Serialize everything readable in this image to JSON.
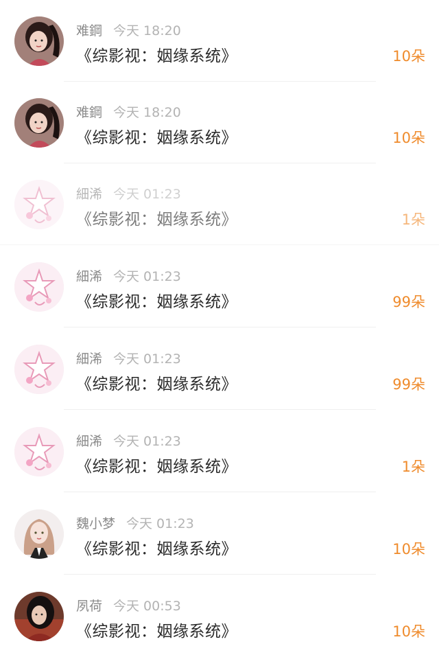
{
  "rows": [
    {
      "user": "难鋼",
      "time": "今天 18:20",
      "title": "《综影视：姻缘系统》",
      "gift": "10朵",
      "avatar": "avatar-girl-red"
    },
    {
      "user": "难鋼",
      "time": "今天 18:20",
      "title": "《综影视：姻缘系统》",
      "gift": "10朵",
      "avatar": "avatar-girl-red"
    },
    {
      "user": "細浠",
      "time": "今天 01:23",
      "title": "《综影视：姻缘系统》",
      "gift": "1朵",
      "avatar": "avatar-star-pink"
    },
    {
      "user": "細浠",
      "time": "今天 01:23",
      "title": "《综影视：姻缘系统》",
      "gift": "99朵",
      "avatar": "avatar-star-pink"
    },
    {
      "user": "細浠",
      "time": "今天 01:23",
      "title": "《综影视：姻缘系统》",
      "gift": "99朵",
      "avatar": "avatar-star-pink"
    },
    {
      "user": "細浠",
      "time": "今天 01:23",
      "title": "《综影视：姻缘系统》",
      "gift": "1朵",
      "avatar": "avatar-star-pink"
    },
    {
      "user": "魏小梦",
      "time": "今天 01:23",
      "title": "《综影视：姻缘系统》",
      "gift": "10朵",
      "avatar": "avatar-anime-girl"
    },
    {
      "user": "夙荷",
      "time": "今天 00:53",
      "title": "《综影视：姻缘系统》",
      "gift": "10朵",
      "avatar": "avatar-girl-dark"
    }
  ],
  "colors": {
    "gift": "#ef8b2c",
    "username": "#8a8a8a",
    "time": "#b3b3b3",
    "title": "#2b2b2b"
  }
}
